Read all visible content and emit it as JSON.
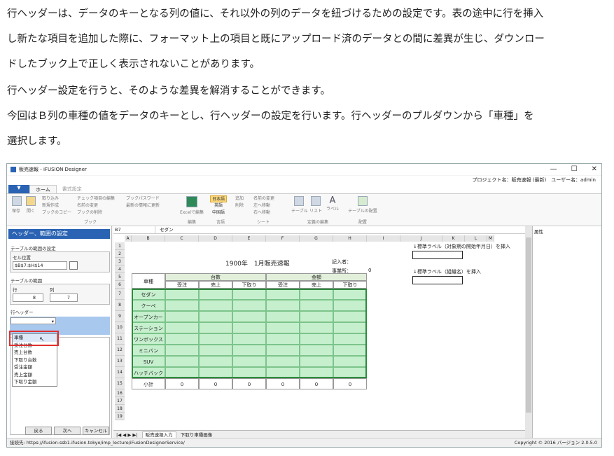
{
  "instructions": {
    "p1": "行ヘッダーは、データのキーとなる列の値に、それ以外の列のデータを紐づけるための設定です。表の途中に行を挿入",
    "p2": "し新たな項目を追加した際に、フォーマット上の項目と既にアップロード済のデータとの間に差異が生じ、ダウンロー",
    "p3": "ドしたブック上で正しく表示されないことがあります。",
    "p4": "行ヘッダー設定を行うと、そのような差異を解消することができます。",
    "p5": "今回はＢ列の車種の値をデータのキーとし、行ヘッダーの設定を行います。行ヘッダーのプルダウンから「車種」を",
    "p6": "選択します。"
  },
  "window": {
    "title": "販売速報 - iFUSION Designer",
    "minimize": "—",
    "maximize": "☐",
    "close": "✕",
    "project": "プロジェクト名：販売速報 (最新)　ユーザー名：admin"
  },
  "tabs": {
    "file": "▼",
    "home": "ホーム",
    "format": "書式設定"
  },
  "ribbon": {
    "save": "保存",
    "open": "開く",
    "import": "取り込み",
    "new": "新規作成",
    "bookcopy": "ブックのコピー",
    "checkitems": "チェック項目の編集",
    "namechange": "名前の変更",
    "bookdelete": "ブックの削除",
    "password": "ブックパスワード",
    "refresh": "最新の情報に更新",
    "book_caption": "ブック",
    "excel_edit": "Excelで編集",
    "edit_caption": "編集",
    "lang_ja": "日本語",
    "lang_en": "英語",
    "lang_zh": "中国語",
    "lang_caption": "言語",
    "add": "追加",
    "delete": "削除",
    "name_change2": "名前の変更",
    "move_left": "左へ移動",
    "move_right": "右へ移動",
    "sheet_caption": "シート",
    "table": "テーブル",
    "list": "リスト",
    "label": "ラベル",
    "def_caption": "定義の編集",
    "table_arrange": "テーブルの配置",
    "arrange_caption": "配置"
  },
  "left_panel": {
    "title": "ヘッダー、範囲の設定",
    "table_range_setting": "テーブルの範囲の設定",
    "cell_position": "セル位置",
    "cell_value": "$B$7:$H$14",
    "table_range": "テーブルの範囲",
    "row": "行",
    "col": "列",
    "row_value": "8",
    "col_value": "7",
    "row_header": "行ヘッダー",
    "dropdown_options": [
      "車種",
      "受注台数",
      "売上台数",
      "下取り台数",
      "受注金額",
      "売上金額",
      "下取り金額"
    ],
    "back": "戻る",
    "next": "次へ",
    "cancel": "キャンセル"
  },
  "sheet": {
    "cellref": "B7",
    "cellvalue": "セダン",
    "columns": [
      "A",
      "B",
      "C",
      "D",
      "E",
      "F",
      "G",
      "H",
      "I",
      "J",
      "K",
      "L",
      "M"
    ],
    "rows": [
      "1",
      "2",
      "3",
      "4",
      "5",
      "6",
      "7",
      "8",
      "9",
      "10",
      "11",
      "12",
      "13",
      "14",
      "15",
      "16",
      "17",
      "18",
      "19"
    ],
    "title": "1900年　1月販売速報",
    "recorder": "記入者：",
    "office": "事業所：",
    "office_value": "0",
    "label_hint1": "↓標準ラベル（対象期の開始年月日）を挿入",
    "label_hint2": "↓標準ラベル（組織名）を挿入",
    "header_type": "車種",
    "header_count": "台数",
    "header_amount": "金額",
    "sub": [
      "受注",
      "売上",
      "下取り",
      "受注",
      "売上",
      "下取り"
    ],
    "types": [
      "セダン",
      "クーペ",
      "オープンカー",
      "ステーションワゴン",
      "ワンボックス",
      "ミニバン",
      "SUV",
      "ハッチバック"
    ],
    "subtotal": "小計",
    "zero": "0",
    "tab1": "販売速報入力",
    "tab2": "下取り車種画像"
  },
  "right_panel": {
    "title": "属性"
  },
  "status": {
    "connection": "接続先: https://ifusion-ssb1.ifusion.tokyo/imp_lecture/iFusionDesignerService/",
    "copyright": "Copyright © 2016  バージョン 2.0.5.0"
  },
  "colors": {
    "accent": "#2a63b3",
    "highlight": "#e03030",
    "green": "#c6efce"
  }
}
